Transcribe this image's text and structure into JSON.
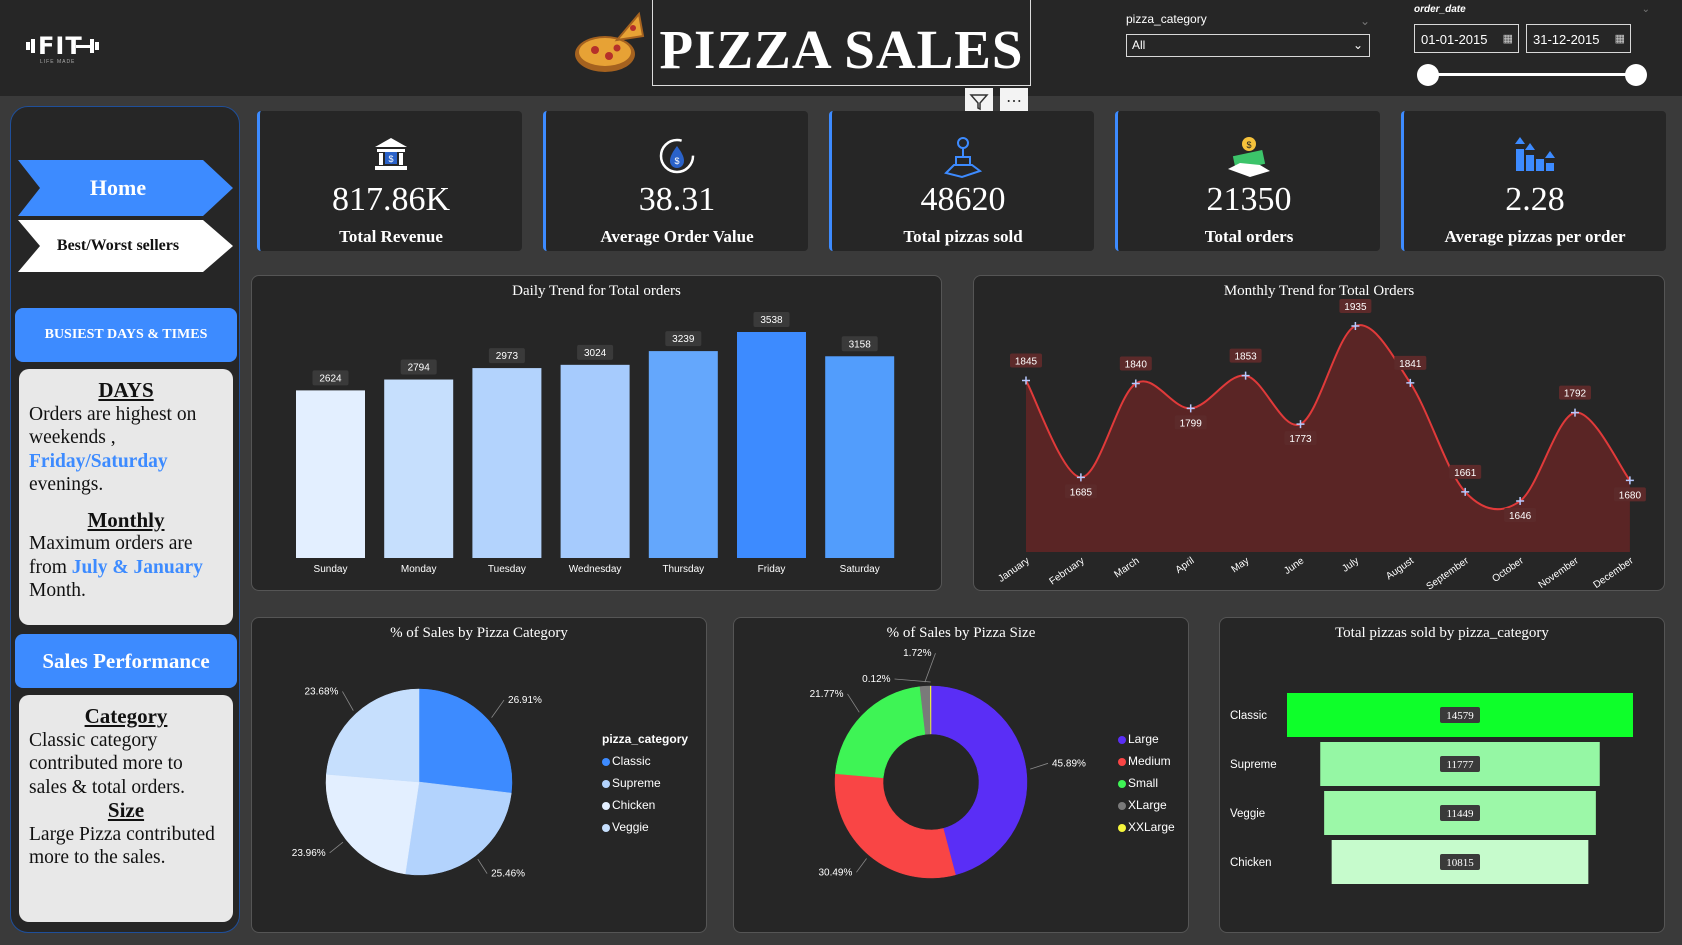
{
  "header": {
    "logo_text": "FIT",
    "logo_sub": "LIFE MADE",
    "title": "PIZZA SALES",
    "category_slicer": {
      "label": "pizza_category",
      "value": "All"
    },
    "date_slicer": {
      "label": "order_date",
      "start": "01-01-2015",
      "end": "31-12-2015"
    }
  },
  "sidebar": {
    "nav": [
      {
        "label": "Home",
        "active": true
      },
      {
        "label": "Best/Worst sellers",
        "active": false
      }
    ],
    "busiest_title": "BUSIEST DAYS & TIMES",
    "days_heading": "DAYS",
    "days_text_1": "Orders are highest on weekends ,",
    "days_highlight": "Friday/Saturday",
    "days_text_2": "evenings.",
    "monthly_heading": "Monthly",
    "monthly_text_1": "Maximum orders are from",
    "monthly_highlight": "July & January",
    "monthly_text_2": "Month.",
    "sales_title": "Sales Performance",
    "category_heading": "Category",
    "category_text": "Classic category contributed more to sales & total orders.",
    "size_heading": "Size",
    "size_text": "Large Pizza contributed more to the sales."
  },
  "kpis": [
    {
      "value": "817.86K",
      "label": "Total Revenue",
      "icon": "bank-icon"
    },
    {
      "value": "38.31",
      "label": "Average Order Value",
      "icon": "money-cycle-icon"
    },
    {
      "value": "48620",
      "label": "Total pizzas sold",
      "icon": "hand-money-icon"
    },
    {
      "value": "21350",
      "label": "Total orders",
      "icon": "cash-hand-icon"
    },
    {
      "value": "2.28",
      "label": "Average pizzas per order",
      "icon": "stacked-bars-icon"
    }
  ],
  "colors": {
    "accent": "#3d8bff",
    "panel": "#262626",
    "line": "#e03a3a",
    "area": "#5a2525"
  },
  "chart_data": [
    {
      "type": "bar",
      "title": "Daily Trend for Total orders",
      "categories": [
        "Sunday",
        "Monday",
        "Tuesday",
        "Wednesday",
        "Thursday",
        "Friday",
        "Saturday"
      ],
      "values": [
        2624,
        2794,
        2973,
        3024,
        3239,
        3538,
        3158
      ],
      "colors": [
        "#e3efff",
        "#c6dffd",
        "#b3d3fd",
        "#a6cbfd",
        "#64a7fc",
        "#3d8bff",
        "#529dfc"
      ]
    },
    {
      "type": "area",
      "title": "Monthly Trend for Total Orders",
      "categories": [
        "January",
        "February",
        "March",
        "April",
        "May",
        "June",
        "July",
        "August",
        "September",
        "October",
        "November",
        "December"
      ],
      "values": [
        1845,
        1685,
        1840,
        1799,
        1853,
        1773,
        1935,
        1841,
        1661,
        1646,
        1792,
        1680
      ]
    },
    {
      "type": "pie",
      "title": "% of Sales by Pizza Category",
      "legend_title": "pizza_category",
      "labels": [
        "Classic",
        "Supreme",
        "Chicken",
        "Veggie"
      ],
      "values": [
        26.91,
        25.46,
        23.96,
        23.68
      ],
      "value_labels": [
        "26.91%",
        "25.46%",
        "23.96%",
        "23.68%"
      ],
      "colors": [
        "#3d8bff",
        "#b3d3fd",
        "#e3efff",
        "#c6dffd"
      ]
    },
    {
      "type": "pie",
      "title": "% of Sales by Pizza Size",
      "labels": [
        "Large",
        "Medium",
        "Small",
        "XLarge",
        "XXLarge"
      ],
      "values": [
        45.89,
        30.49,
        21.77,
        1.72,
        0.12
      ],
      "value_labels": [
        "45.89%",
        "30.49%",
        "21.77%",
        "1.72%",
        "0.12%"
      ],
      "colors": [
        "#5a2ef6",
        "#f94545",
        "#3ef455",
        "#7a7a7a",
        "#f5f53c"
      ],
      "legend_colors": [
        "#5a2ef6",
        "#f94545",
        "#3ef455",
        "#7a7a7a",
        "#f5f53c"
      ]
    },
    {
      "type": "bar",
      "orientation": "funnel",
      "title": "Total pizzas sold by pizza_category",
      "categories": [
        "Classic",
        "Supreme",
        "Veggie",
        "Chicken"
      ],
      "values": [
        14579,
        11777,
        11449,
        10815
      ],
      "colors": [
        "#0eff2a",
        "#95f7a4",
        "#9cf8a8",
        "#c6fbcc"
      ]
    }
  ]
}
